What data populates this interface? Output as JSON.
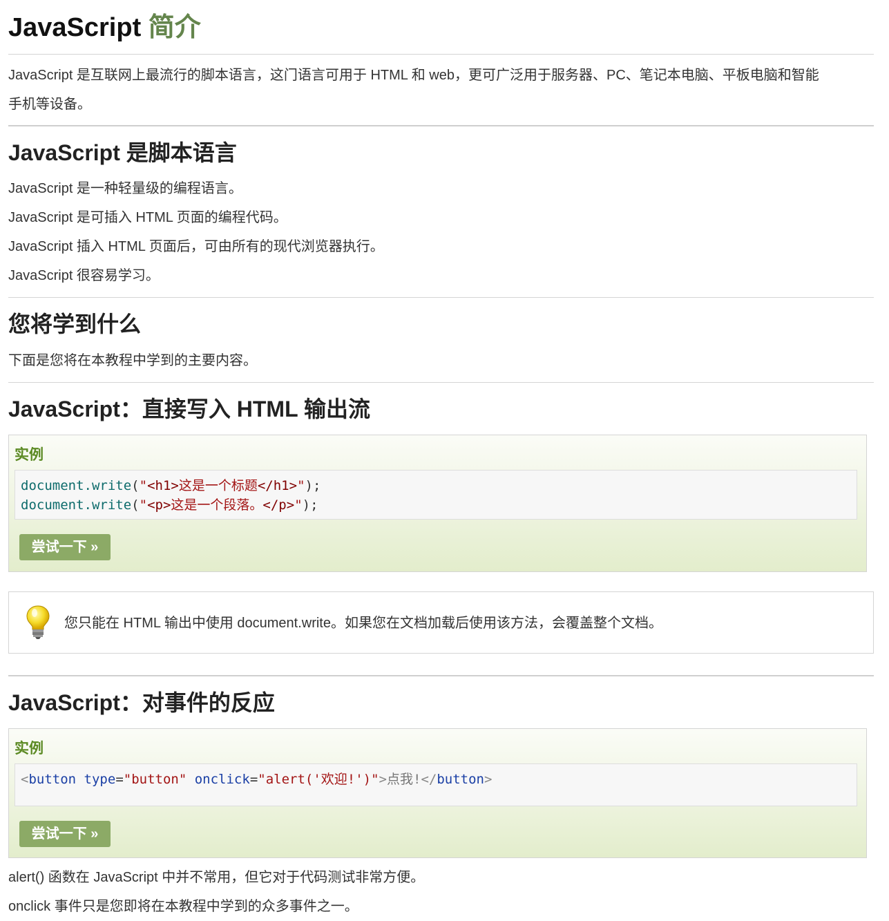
{
  "title": {
    "main": "JavaScript",
    "accent": "简介"
  },
  "intro": {
    "line1": "JavaScript 是互联网上最流行的脚本语言，这门语言可用于 HTML 和 web，更可广泛用于服务器、PC、笔记本电脑、平板电脑和智能",
    "line2": "手机等设备。"
  },
  "section_script": {
    "heading": "JavaScript 是脚本语言",
    "lines": [
      "JavaScript 是一种轻量级的编程语言。",
      "JavaScript 是可插入 HTML 页面的编程代码。",
      "JavaScript 插入 HTML 页面后，可由所有的现代浏览器执行。",
      "JavaScript 很容易学习。"
    ]
  },
  "section_learn": {
    "heading": "您将学到什么",
    "text": "下面是您将在本教程中学到的主要内容。"
  },
  "section_write": {
    "heading": "JavaScript：直接写入 HTML 输出流",
    "example_title": "实例",
    "code": {
      "line1": {
        "obj": "document",
        "dot": ".",
        "fn": "write",
        "open": "(",
        "q1": "\"",
        "tag_open": "<h1>",
        "text": "这是一个标题",
        "tag_close": "</h1>",
        "q2": "\"",
        "close": ");"
      },
      "line2": {
        "obj": "document",
        "dot": ".",
        "fn": "write",
        "open": "(",
        "q1": "\"",
        "tag_open": "<p>",
        "text": "这是一个段落。",
        "tag_close": "</p>",
        "q2": "\"",
        "close": ");"
      }
    },
    "try_label": "尝试一下 »"
  },
  "tip": {
    "icon": "lightbulb-icon",
    "text": "您只能在 HTML 输出中使用 document.write。如果您在文档加载后使用该方法，会覆盖整个文档。"
  },
  "section_events": {
    "heading": "JavaScript：对事件的反应",
    "example_title": "实例",
    "code": {
      "lt": "<",
      "el": "button",
      "attr1": "type",
      "eq1": "=",
      "val1": "\"button\"",
      "attr2": "onclick",
      "eq2": "=",
      "val2": "\"alert('欢迎!')\"",
      "gt": ">",
      "content": "点我!",
      "close_lt": "</",
      "close_el": "button",
      "close_gt": ">"
    },
    "try_label": "尝试一下 »"
  },
  "footer_text": {
    "line1": "alert() 函数在 JavaScript 中并不常用，但它对于代码测试非常方便。",
    "line2": "onclick 事件只是您即将在本教程中学到的众多事件之一。"
  },
  "colors": {
    "accent_green": "#64854c",
    "example_title": "#5c8a24",
    "button_bg": "#8caa66"
  }
}
